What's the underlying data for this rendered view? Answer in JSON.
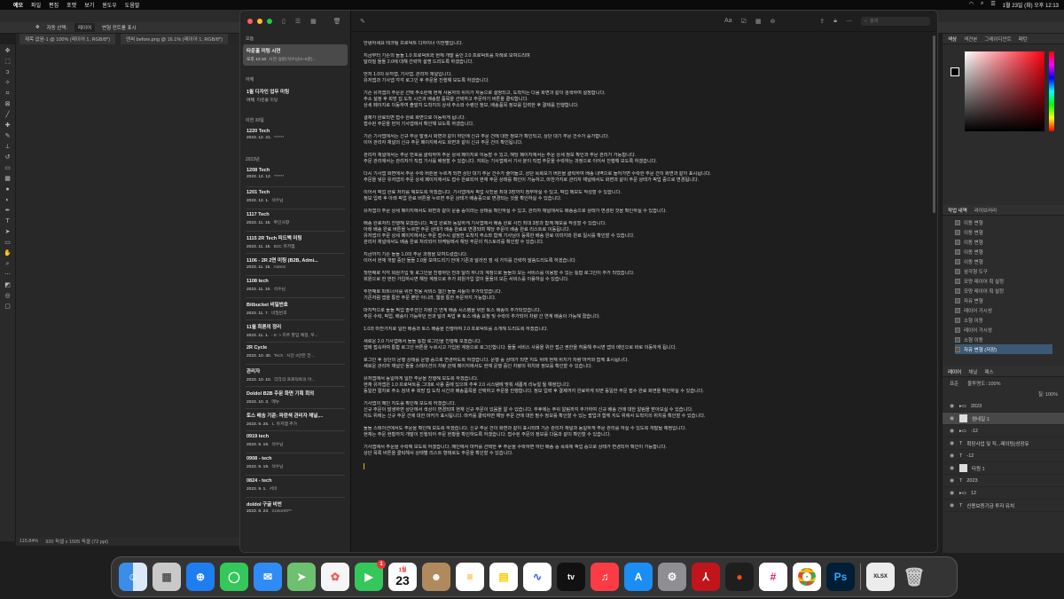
{
  "menubar": {
    "items": [
      "예모",
      "파일",
      "편집",
      "포맷",
      "보기",
      "윈도우",
      "도움말"
    ],
    "clock": "1월 23일 (화) 오후 12:13"
  },
  "photoshop": {
    "options": [
      "자동 선택:",
      "레이어",
      "변형 컨트롤 표시"
    ],
    "doc_tabs": [
      "제목 없음-1 @ 100% (레이어 1, RGB/8*)",
      "앤써 before.png @ 16.1% (레이어 1, RGB/8*)"
    ],
    "status_zoom": "115.84%",
    "status_size": "920 픽셀 x 1505 픽셀 (72 ppi)",
    "panel_tabs_color": [
      "색상",
      "색견본",
      "그레이디언트",
      "패턴"
    ],
    "panel_tabs_history": [
      "작업 내역",
      "라이브러리"
    ],
    "history_items": [
      "이동 변형",
      "이동 변형",
      "이동 변형",
      "이동 변형",
      "이동 변형",
      "삼각형 도구",
      "모양 레이어 획 설정",
      "모양 레이어 획 설정",
      "자유 변형",
      "레이어 가시성",
      "소형 이동",
      "레이어 가시성",
      "소형 이동",
      "자유 변형 (저장)"
    ],
    "panel_tabs_layers": [
      "레이어",
      "채널",
      "패스"
    ],
    "layer_blend": "표준",
    "layer_opacity_label": "불투명도: 100%",
    "layer_fill_label": "칠: 100%",
    "layers": [
      "2023",
      "썸네일 1",
      "-12",
      "확장사업 및 직...레이팅(성장유",
      "-12",
      "타원 1",
      "2023",
      "12",
      "신용보증기금 투자 유치"
    ]
  },
  "notes": {
    "sections": {
      "today": "오늘",
      "yesterday": "어제",
      "prev30": "이전 30일",
      "year2023": "2023년"
    },
    "today_notes": [
      {
        "title": "타운홀 미팅 시연",
        "date": "오후 12:10",
        "preview": "시연 설문(석수님/3~5분)..."
      }
    ],
    "yesterday_notes": [
      {
        "title": "1월 디자인 업무 미팅",
        "date": "어제",
        "preview": "타운홀 미팅"
      }
    ],
    "prev30_notes": [
      {
        "title": "1220 Tech",
        "date": "2023. 12. 21.",
        "preview": "******"
      }
    ],
    "year_notes": [
      {
        "title": "1208 Tech",
        "date": "2023. 12. 12.",
        "preview": "******"
      },
      {
        "title": "1201 Tech",
        "date": "2023. 12. 1.",
        "preview": "석수님"
      },
      {
        "title": "1117 Tech",
        "date": "2023. 11. 15.",
        "preview": "확인사항"
      },
      {
        "title": "1115 2R Tech 피드백 미팅",
        "date": "2023. 11. 15.",
        "preview": "B2C 유저앱"
      },
      {
        "title": "1106 - 2R 2면 미팅 (B2B, Admi...",
        "date": "2023. 11. 15.",
        "preview": "Admin"
      },
      {
        "title": "1108 tech",
        "date": "2023. 11. 10.",
        "preview": "석수님"
      },
      {
        "title": "Bitbucket 비밀번호",
        "date": "2023. 11. 7.",
        "preview": "비밀번호"
      },
      {
        "title": "11월 희론의 정리",
        "date": "2023. 11. 1.",
        "preview": "- 8: > 피주 할임 예정, 우..."
      },
      {
        "title": "2R Cycle",
        "date": "2023. 10. 30.",
        "preview": "Tech : 시안 3안은 전..."
      },
      {
        "title": "관리자",
        "date": "2023. 10. 10.",
        "preview": "각각의 프로덕트의 어..."
      },
      {
        "title": "Doldol B2B 주문 화면 기획 회의",
        "date": "2023. 10. 3.",
        "preview": "메뉴"
      },
      {
        "title": "토스 배송 기준: 파란색 관리자 채널,...",
        "date": "2023. 9. 25.",
        "preview": "1. 유저앱 추가"
      },
      {
        "title": "0919 tech",
        "date": "2023. 9. 19.",
        "preview": "석수님"
      },
      {
        "title": "0908 - tech",
        "date": "2023. 9. 19.",
        "preview": "석수님"
      },
      {
        "title": "0824 - tech",
        "date": "2023. 9. 1.",
        "preview": "서비"
      },
      {
        "title": "doldol 구글 비번",
        "date": "2023. 8. 23.",
        "preview": "21stor00**"
      }
    ],
    "search_placeholder": "검색",
    "body": [
      "안녕하세요 테크팀 프로덕트 디자이너 이한별입니다.",
      "지금부터 기존의 돌돌 1.0 프로덕트와 현재 개발 중인 2.0 프로덕트를 차례로 보여드리며\n달라질 돌돌 2.0에 대해 간략히 설명 드리도록 하겠습니다.",
      "먼저 1.0의 유저앱, 기사앱, 관리자 채널입니다.\n유저앱과 기사앱 각각 로그인 후 주문을 진행해 보도록 하겠습니다.",
      "기존 유저앱의 주문은 선택 주소란에 현재 사용자의 위치가 자동으로 설정되고, 도착지는 다음 화면과 같이 검색하여 설정합니다.\n주소 설정 후 희망 집 도착 시간과 배송할 품목을 선택하고 주문하기 버튼을 클릭합니다.\n상세 페이지로 이동하여 출발지 도착지의 상세 주소와 수령인 정보, 배송품목 정보를 입력한 후 결제를 진행합니다.",
      "결제가 완료되면 접수 완료 화면으로 이동하게 됩니다.\n접수된 주문을 먼저 기사앱에서 확인해 보도록 하겠습니다.",
      "기존 기사앱에서는 신규 주문 발생시 화면과 같이 하단에 신규 주문 건에 대한 정보가 확인되고, 상단 대기 주문 건수가 증가합니다.\n이어 관리자 채널의 신규 주문 페이지에서도 화면과 같이 신규 주문 건이 확인됩니다.",
      "관리자 채널에서는 주문 번호를 클릭하여 주문 상세 페이지로 이동할 수 있고, 해당 페이지에서는 주문 상세 정보 확인과 주문 관리가 가능합니다.\n주문 관리에서는 관리자가 직접 기사를 배정할 수 있습니다. 저희는 기사앱에서 기사 분이 직접 주문을 수락하는 과정으로 이어서 진행해 보도록 하겠습니다.",
      "다시 기사앱 화면에서 주문 수락 버튼을 누르게 되면 상단 대기 주문 건수가 줄어들고, 상단 목록보기 버튼을 클릭하여 배송 내역으로 들어가면 수락한 주문 건이 화면과 같이 표시됩니다.\n주문을 넣은 유저앱의 주문 상세 페이지에서도 접수 완료되어 현재 주문 상태를 확인이 가능하고, 마찬가지로 관리자 채널에서도 화면과 같이 주문 상태가 픽업 중으로 변경됩니다.",
      "이어서 픽업 완료 처리를 해보도록 하겠습니다. 기사앱에서 픽업 사진을 최대 3장까지 첨부하실 수 있고, 픽업 메모도 작성할 수 있습니다.\n정보 입력 후 아래 픽업 완료 버튼을 누르면 주문 상태가 배송중으로 변경되는 것을 확인하실 수 있습니다.",
      "유저앱의 주문 상세 페이지에서도 화면과 같이 운송 중이라는 상태를 확인하실 수 있고, 관리자 채널에서도 배송중으로 상태가 변경된 것을 확인하실 수 있습니다.",
      "배송 완료처리 진행해 보겠습니다. 픽업 완료와 동일하게 기사앱에서 배송 완료 사진 최대 3장과 함께 메모를 작성할 수 있습니다.\n아래 배송 완료 버튼을 누르면 주문 상태가 배송 완료로 변경되며 해당 주문이 배송 완료 리스트로 이동됩니다.\n유저앱의 주문 상세 페이지에서는 주문 접수시 설정한 도착지 주소와 함께 기사님이 등록한 배송 완료 이미지와 완료 일시를 확인할 수 있습니다.\n관리자 채널에서도 배송 완료 처리되어 마케팅에서 해당 주문의 히스토리를 확인할 수 있습니다.",
      "지금까지 기존 돌돌 1.0의 주문 과정을 보여드렸습니다.\n이어서 현재 개발 중인 돌돌 2.0을 보여드리기 전에 기존과 달라진 점 세 가지를 간략히 말씀드리도록 하겠습니다.",
      "첫번째로 각각 회원가입 및 로그인을 진행하던 전과 달리 하나의 계정으로 돌돌의 모든 서비스를 이용할 수 있는 통합 로그인이 추가 되었습니다.\n회원으로 한 번만 가입하시면 해당 계정으로 추가 회원가입 없이 돌돌의 모든 서비스를 이용하실 수 있습니다.",
      "두번째로 파트너사를 위한 전용 서비스 웹인 돌돌 셔틀이 추가되었습니다.\n기존처럼 앱을 통한 주문 뿐만 아니라, 웹을 통한 주문까지 가능합니다.",
      "마지막으로 돌돌 픽업 솔루션인 차량 간 연계 배송 시스템을 위한 토스 배송이 추가되었습니다.\n주문 수락, 픽업, 배송이 가능하던 전과 달리 픽업 후 토스 배송 요청 및 수락이 추가되어 차량 간 연계 배송이 가능해 졌습니다.",
      "1.0과 마찬가지로 일반 배송과 토스 배송을 진행하여 2.0 프로덕트를 소개해 드리도록 하겠습니다.",
      "새로운 2.0 기사앱에서 돌돌 통합 로그인을 진행해 보겠습니다.\n앱에 접속하여 통합 로그인 버튼을 누르시고 가입된 계정으로 로그인합니다. 돌돌 서비스 사용을 위한 접근 권한을 허용해 주시면 앱의 메인으로 바로 이동하게 됩니다.",
      "로그인 후 상단의 운행 상태를 운행 중으로 변경하도록 하겠습니다. 운행 중 상태가 되면 지도 위에 현재 위치가 차량 마커와 함께 표시됩니다.\n새로운 관리자 채널인 돌돌 스테이션의 차량 관제 페이지에서도 현재 운행 중인 차량의 위치와 정보를 확인할 수 있습니다.",
      "유저앱에서 동일하게 일반 주문을 진행해 보도록 하겠습니다.\n현재 유저앱은 1.0 프로덕트를 그대로 사용 중에 있으며 추후 2.0 시스템에 맞춰 새롭게 리뉴얼 될 예정입니다.\n동일한 절차로 주소 검색 후 희망 집 도착 시간과 배송품목을 선택하고 주문을 진행합니다. 정보 입력 후 결제까지 완료하게 되면 동일한 주문 접수 완료 화면을 확인하실 수 있습니다.",
      "기사앱의 메인 지도를 확인해 보도록 하겠습니다.\n신규 주문이 발생하면 상단에서 색상이 변경되며 현재 신규 주문이 있음을 알 수 있습니다. 추후에는 푸쉬 알림까지 추가하여 신규 배송 건에 대한 알림을 받아보실 수 있습니다.\n지도 위에는 신규 주문 건에 대한 마커가 표시됩니다. 마커를 클릭하면 해당 주문 건에 대한 필수 정보를 확인할 수 있는 팝업과 함께 지도 위에서 도착지의 위치를 확인할 수 있습니다.",
      "돌돌 스테이션에서도 주문을 확인해 보도록 하겠습니다. 신규 주문 건이 화면과 같이 표시되며 기존 관리자 채널과 동일하게 주문 관리를 하실 수 있도록 개발될 예정입니다.\n현재는 주문 현황까지 개발이 진행되어 주문 현황을 확인하도록 하겠습니다. 접수된 주문의 정보를 다음과 같이 확인할 수 있습니다.",
      "기사앱에서 주문을 수락해 보도록 하겠습니다. 메인에서 마커를 선택한 후 주문을 수락하면 하단 배송 중 목록에 픽업 중으로 상태가 변경되어 확인이 가능합니다.\n상단 목록 버튼을 클릭해서 상태별 리스트 형태로도 주문을 확인할 수 있습니다."
    ]
  },
  "dock": {
    "apps": [
      "Finder",
      "Launchpad",
      "Safari",
      "Messages",
      "Mail",
      "Maps",
      "Photos",
      "FaceTime",
      "Calendar",
      "Contacts",
      "Reminders",
      "Notes",
      "Freeform",
      "TV",
      "Music",
      "App Store",
      "System Settings",
      "Acrobat",
      "Figma",
      "Slack",
      "Chrome",
      "Photoshop",
      "Downloads",
      "Trash"
    ],
    "calendar_month": "1월",
    "calendar_day": "23",
    "facetime_badge": "1",
    "ps_label": "Ps",
    "tv_label": "tv",
    "xlsx_label": "XLSX"
  }
}
